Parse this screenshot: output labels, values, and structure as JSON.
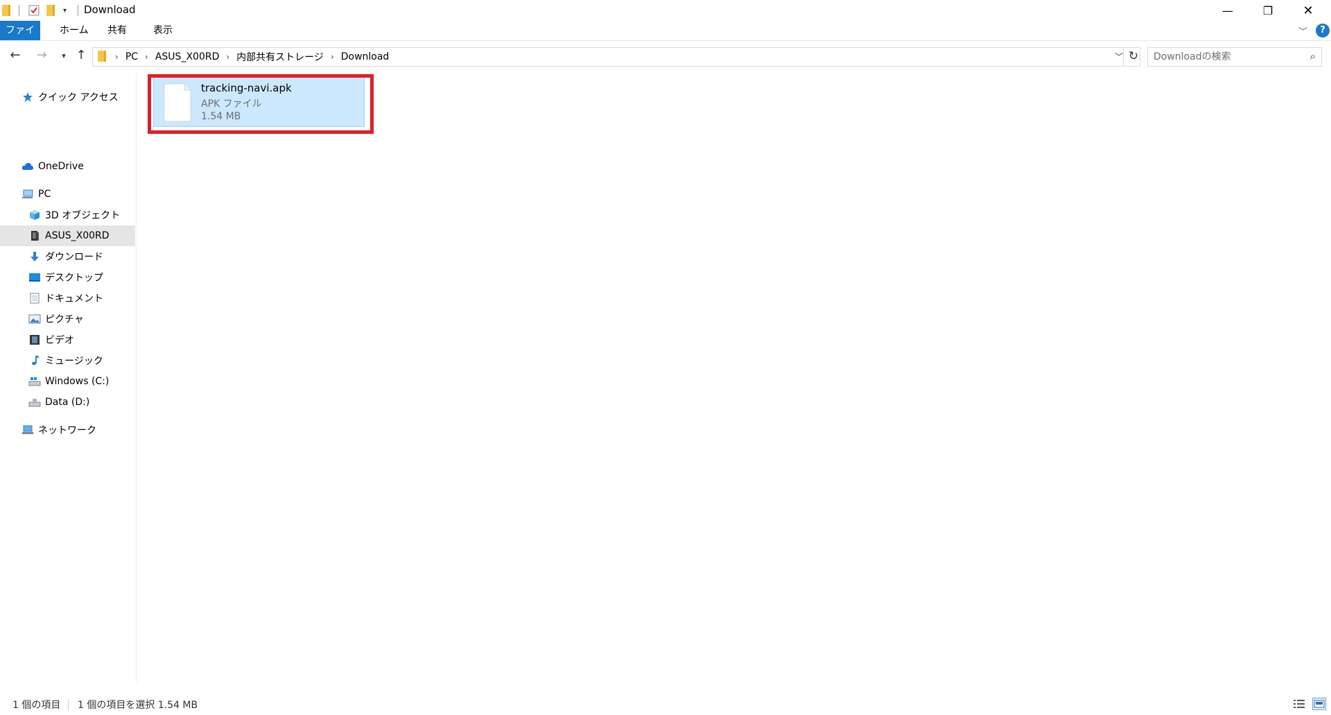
{
  "window": {
    "title": "Download",
    "minimize_label": "—",
    "maximize_label": "❐",
    "close_label": "✕"
  },
  "ribbon": {
    "tabs": [
      {
        "label": "ファイル"
      },
      {
        "label": "ホーム"
      },
      {
        "label": "共有"
      },
      {
        "label": "表示"
      }
    ],
    "accent_color": "#1979ca"
  },
  "address": {
    "crumbs": [
      "PC",
      "ASUS_X00RD",
      "内部共有ストレージ",
      "Download"
    ]
  },
  "search": {
    "placeholder": "Downloadの検索"
  },
  "sidebar": {
    "items": [
      {
        "label": "クイック アクセス",
        "icon": "star-icon"
      },
      {
        "label": "OneDrive",
        "icon": "cloud-icon"
      },
      {
        "label": "PC",
        "icon": "computer-icon"
      },
      {
        "label": "3D オブジェクト",
        "icon": "cube-icon"
      },
      {
        "label": "ASUS_X00RD",
        "icon": "phone-icon"
      },
      {
        "label": "ダウンロード",
        "icon": "download-arrow-icon"
      },
      {
        "label": "デスクトップ",
        "icon": "desktop-icon"
      },
      {
        "label": "ドキュメント",
        "icon": "document-icon"
      },
      {
        "label": "ピクチャ",
        "icon": "picture-icon"
      },
      {
        "label": "ビデオ",
        "icon": "film-icon"
      },
      {
        "label": "ミュージック",
        "icon": "music-note-icon"
      },
      {
        "label": "Windows (C:)",
        "icon": "drive-icon"
      },
      {
        "label": "Data (D:)",
        "icon": "drive-icon"
      },
      {
        "label": "ネットワーク",
        "icon": "network-icon"
      }
    ],
    "selected": "ASUS_X00RD"
  },
  "files": [
    {
      "name": "tracking-navi.apk",
      "type": "APK ファイル",
      "size": "1.54 MB",
      "selected": true,
      "highlighted": true
    }
  ],
  "status": {
    "count": "1 個の項目",
    "selected": "1 個の項目を選択  1.54 MB"
  },
  "colors": {
    "selection_bg": "#cce8ff",
    "highlight_border": "#e01e28"
  }
}
